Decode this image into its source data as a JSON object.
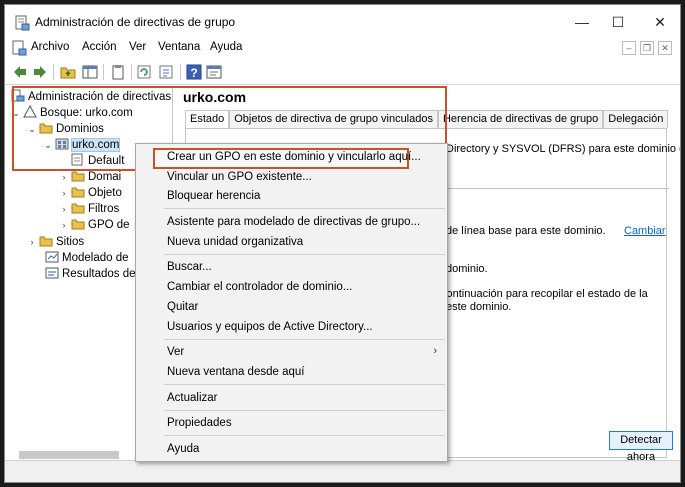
{
  "window": {
    "title": "Administración de directivas de grupo",
    "controls": [
      "—",
      "☐",
      "✕"
    ]
  },
  "menu": [
    "Archivo",
    "Acción",
    "Ver",
    "Ventana",
    "Ayuda"
  ],
  "tree": {
    "root": "Administración de directivas d",
    "forest": "Bosque: urko.com",
    "domains": "Dominios",
    "domain": "urko.com",
    "children": [
      "Default",
      "Domai",
      "Objeto",
      "Filtros",
      "GPO de"
    ],
    "sites": "Sitios",
    "modeling": "Modelado de",
    "results": "Resultados de"
  },
  "right": {
    "title": "urko.com",
    "tabs": [
      "Estado",
      "Objetos de directiva de grupo vinculados",
      "Herencia de directivas de grupo",
      "Delegación"
    ],
    "line1a": "Directory y SYSVOL (DFRS) para este dominio en",
    "line1b": "",
    "line2": "de línea base para este dominio.",
    "change_link": "Cambiar",
    "line3": "dominio.",
    "line4a": "continuación para recopilar el estado de la",
    "line4b": "este dominio.",
    "detect_button": "Detectar ahora"
  },
  "context_menu": {
    "items": [
      "Crear un GPO en este dominio y vincularlo aquí...",
      "Vincular un GPO existente...",
      "Bloquear herencia",
      "Asistente para modelado de directivas de grupo...",
      "Nueva unidad organizativa",
      "Buscar...",
      "Cambiar el controlador de dominio...",
      "Quitar",
      "Usuarios y equipos de Active Directory...",
      "Ver",
      "Nueva ventana desde aquí",
      "Actualizar",
      "Propiedades",
      "Ayuda"
    ],
    "submenu_arrow": "›"
  },
  "colors": {
    "highlight": "#c8522c",
    "selection": "#cce4f7",
    "link": "#0b62c4"
  }
}
